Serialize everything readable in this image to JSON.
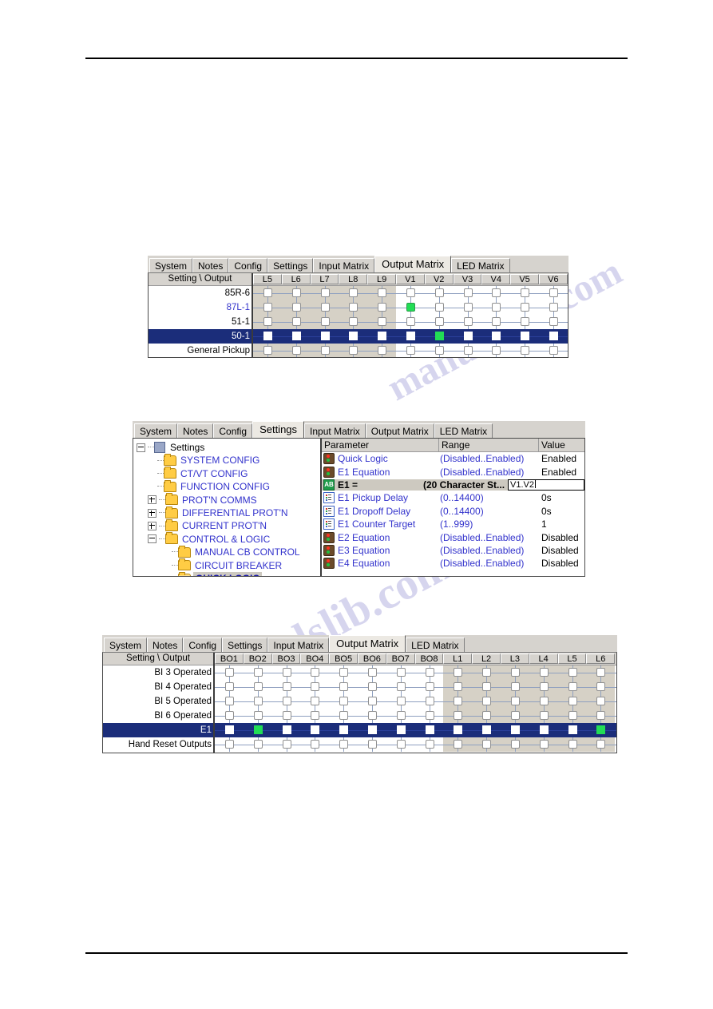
{
  "document": {
    "background": "#ffffff",
    "rules": [
      "top-rule",
      "bottom-rule"
    ],
    "watermark_text": "manualslib.com"
  },
  "panel1": {
    "name": "output-matrix-top",
    "tabs": [
      {
        "label": "System",
        "selected": false
      },
      {
        "label": "Notes",
        "selected": false
      },
      {
        "label": "Config",
        "selected": false
      },
      {
        "label": "Settings",
        "selected": false
      },
      {
        "label": "Input Matrix",
        "selected": false
      },
      {
        "label": "Output Matrix",
        "selected": true
      },
      {
        "label": "LED Matrix",
        "selected": false
      }
    ],
    "corner_header": "Setting \\ Output",
    "columns": [
      "L5",
      "L6",
      "L7",
      "L8",
      "L9",
      "V1",
      "V2",
      "V3",
      "V4",
      "V5",
      "V6"
    ],
    "shaded_columns": 5,
    "rows": [
      {
        "label": "85R-6",
        "style": "normal",
        "selected": false,
        "checked": []
      },
      {
        "label": "87L-1",
        "style": "blue",
        "selected": false,
        "checked": [
          "V1"
        ]
      },
      {
        "label": "51-1",
        "style": "normal",
        "selected": false,
        "checked": []
      },
      {
        "label": "50-1",
        "style": "normal",
        "selected": true,
        "checked": [
          "V2"
        ]
      },
      {
        "label": "General Pickup",
        "style": "normal",
        "selected": false,
        "checked": []
      }
    ]
  },
  "panel2": {
    "name": "settings-quick-logic",
    "tabs": [
      {
        "label": "System",
        "selected": false
      },
      {
        "label": "Notes",
        "selected": false
      },
      {
        "label": "Config",
        "selected": false
      },
      {
        "label": "Settings",
        "selected": true
      },
      {
        "label": "Input Matrix",
        "selected": false
      },
      {
        "label": "Output Matrix",
        "selected": false
      },
      {
        "label": "LED Matrix",
        "selected": false
      }
    ],
    "tree": [
      {
        "label": "Settings",
        "level": 0,
        "icon": "document-icon",
        "expander": "minus",
        "selected": false
      },
      {
        "label": "SYSTEM CONFIG",
        "level": 1,
        "icon": "folder-icon",
        "expander": "none",
        "selected": false
      },
      {
        "label": "CT/VT CONFIG",
        "level": 1,
        "icon": "folder-icon",
        "expander": "none",
        "selected": false
      },
      {
        "label": "FUNCTION CONFIG",
        "level": 1,
        "icon": "folder-icon",
        "expander": "none",
        "selected": false
      },
      {
        "label": "PROT'N COMMS",
        "level": 1,
        "icon": "folder-icon",
        "expander": "plus",
        "selected": false
      },
      {
        "label": "DIFFERENTIAL PROT'N",
        "level": 1,
        "icon": "folder-icon",
        "expander": "plus",
        "selected": false
      },
      {
        "label": "CURRENT PROT'N",
        "level": 1,
        "icon": "folder-icon",
        "expander": "plus",
        "selected": false
      },
      {
        "label": "CONTROL & LOGIC",
        "level": 1,
        "icon": "folder-icon",
        "expander": "minus",
        "selected": false
      },
      {
        "label": "MANUAL CB CONTROL",
        "level": 2,
        "icon": "folder-icon",
        "expander": "none",
        "selected": false
      },
      {
        "label": "CIRCUIT BREAKER",
        "level": 2,
        "icon": "folder-icon",
        "expander": "none",
        "selected": false
      },
      {
        "label": "QUICK LOGIC",
        "level": 2,
        "icon": "folder-open-icon",
        "expander": "none",
        "selected": true
      }
    ],
    "param_headers": [
      "Parameter",
      "Range",
      "Value"
    ],
    "params": [
      {
        "icon": "enum-icon",
        "name": "Quick Logic",
        "range": "(Disabled..Enabled)",
        "value": "Enabled",
        "editing": false
      },
      {
        "icon": "enum-icon",
        "name": "E1 Equation",
        "range": "(Disabled..Enabled)",
        "value": "Enabled",
        "editing": false
      },
      {
        "icon": "string-icon",
        "name": "E1 =",
        "range": "(20 Character St...",
        "value": "V1.V2",
        "editing": true
      },
      {
        "icon": "number-icon",
        "name": "E1 Pickup Delay",
        "range": "(0..14400)",
        "value": "0s",
        "editing": false
      },
      {
        "icon": "number-icon",
        "name": "E1 Dropoff Delay",
        "range": "(0..14400)",
        "value": "0s",
        "editing": false
      },
      {
        "icon": "number-icon",
        "name": "E1 Counter Target",
        "range": "(1..999)",
        "value": "1",
        "editing": false
      },
      {
        "icon": "enum-icon",
        "name": "E2 Equation",
        "range": "(Disabled..Enabled)",
        "value": "Disabled",
        "editing": false
      },
      {
        "icon": "enum-icon",
        "name": "E3 Equation",
        "range": "(Disabled..Enabled)",
        "value": "Disabled",
        "editing": false
      },
      {
        "icon": "enum-icon",
        "name": "E4 Equation",
        "range": "(Disabled..Enabled)",
        "value": "Disabled",
        "editing": false
      }
    ],
    "string_icon_text": "AB"
  },
  "panel3": {
    "name": "output-matrix-bottom",
    "tabs": [
      {
        "label": "System",
        "selected": false
      },
      {
        "label": "Notes",
        "selected": false
      },
      {
        "label": "Config",
        "selected": false
      },
      {
        "label": "Settings",
        "selected": false
      },
      {
        "label": "Input Matrix",
        "selected": false
      },
      {
        "label": "Output Matrix",
        "selected": true
      },
      {
        "label": "LED Matrix",
        "selected": false
      }
    ],
    "corner_header": "Setting \\ Output",
    "columns": [
      "BO1",
      "BO2",
      "BO3",
      "BO4",
      "BO5",
      "BO6",
      "BO7",
      "BO8",
      "L1",
      "L2",
      "L3",
      "L4",
      "L5",
      "L6"
    ],
    "shaded_start_index": 8,
    "rows": [
      {
        "label": "BI 3 Operated",
        "style": "normal",
        "selected": false,
        "checked": []
      },
      {
        "label": "BI 4 Operated",
        "style": "normal",
        "selected": false,
        "checked": []
      },
      {
        "label": "BI 5 Operated",
        "style": "normal",
        "selected": false,
        "checked": []
      },
      {
        "label": "BI 6 Operated",
        "style": "normal",
        "selected": false,
        "checked": []
      },
      {
        "label": "E1",
        "style": "normal",
        "selected": true,
        "checked": [
          "BO2",
          "L6"
        ]
      },
      {
        "label": "Hand Reset Outputs",
        "style": "normal",
        "selected": false,
        "checked": []
      }
    ]
  }
}
